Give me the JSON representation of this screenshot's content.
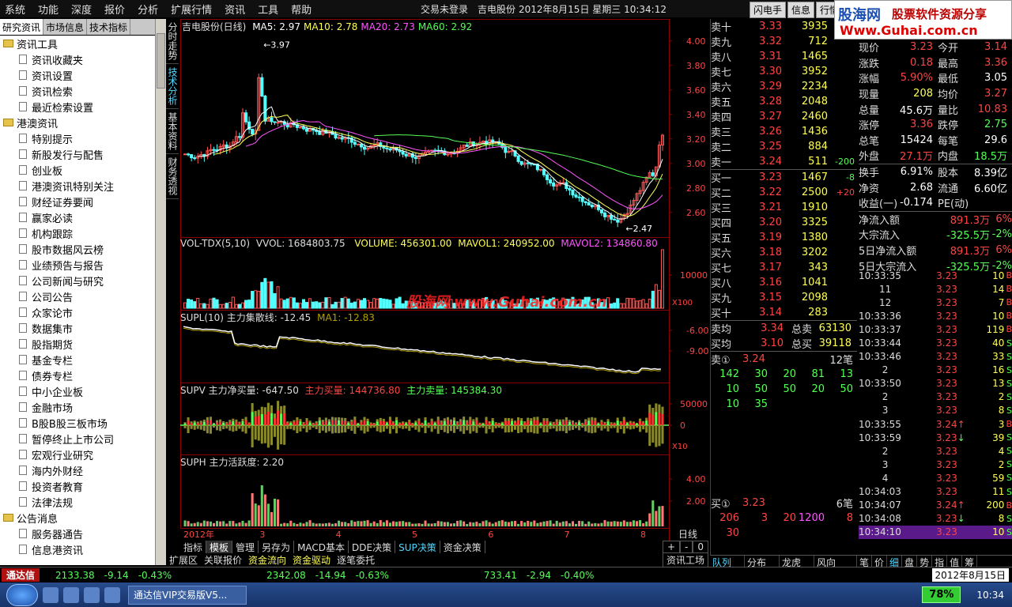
{
  "menu": [
    "系统",
    "功能",
    "深度",
    "报价",
    "分析",
    "扩展行情",
    "资讯",
    "工具",
    "帮助"
  ],
  "status": {
    "login": "交易未登录",
    "stock": "吉电股份",
    "datetime": "2012年8月15日  星期三  10:34:12"
  },
  "top_buttons": [
    "闪电手",
    "信息",
    "行情"
  ],
  "logo": {
    "name": "股海网",
    "slogan": "股票软件资源分享",
    "url": "Www.Guhai.com.cn"
  },
  "left_tabs": [
    "研究资讯",
    "市场信息",
    "技术指标"
  ],
  "tree": [
    {
      "t": "f",
      "label": "资讯工具"
    },
    {
      "t": "d",
      "label": "资讯收藏夹"
    },
    {
      "t": "d",
      "label": "资讯设置"
    },
    {
      "t": "d",
      "label": "资讯检索"
    },
    {
      "t": "d",
      "label": "最近检索设置"
    },
    {
      "t": "f",
      "label": "港澳资讯"
    },
    {
      "t": "d",
      "label": "特别提示"
    },
    {
      "t": "d",
      "label": "新股发行与配售"
    },
    {
      "t": "d",
      "label": "创业板"
    },
    {
      "t": "d",
      "label": "港澳资讯特别关注"
    },
    {
      "t": "d",
      "label": "财经证券要闻"
    },
    {
      "t": "d",
      "label": "赢家必读"
    },
    {
      "t": "d",
      "label": "机构跟踪"
    },
    {
      "t": "d",
      "label": "股市数据风云榜"
    },
    {
      "t": "d",
      "label": "业绩预告与报告"
    },
    {
      "t": "d",
      "label": "公司新闻与研究"
    },
    {
      "t": "d",
      "label": "公司公告"
    },
    {
      "t": "d",
      "label": "众家论市"
    },
    {
      "t": "d",
      "label": "数据集市"
    },
    {
      "t": "d",
      "label": "股指期货"
    },
    {
      "t": "d",
      "label": "基金专栏"
    },
    {
      "t": "d",
      "label": "债券专栏"
    },
    {
      "t": "d",
      "label": "中小企业板"
    },
    {
      "t": "d",
      "label": "金融市场"
    },
    {
      "t": "d",
      "label": "B股B股三板市场"
    },
    {
      "t": "d",
      "label": "暂停终止上市公司"
    },
    {
      "t": "d",
      "label": "宏观行业研究"
    },
    {
      "t": "d",
      "label": "海内外财经"
    },
    {
      "t": "d",
      "label": "投资者教育"
    },
    {
      "t": "d",
      "label": "法律法规"
    },
    {
      "t": "f",
      "label": "公告消息"
    },
    {
      "t": "d",
      "label": "服务器通告"
    },
    {
      "t": "d",
      "label": "信息港资讯"
    }
  ],
  "vtabs": [
    "分时走势",
    "技术分析",
    "基本资料",
    "财务透视"
  ],
  "chart_data": {
    "type": "candlestick",
    "title": "吉电股份(日线)",
    "ma": [
      {
        "name": "MA5",
        "value": "2.97",
        "color": "#ffffff"
      },
      {
        "name": "MA10",
        "value": "2.78",
        "color": "#ffff55"
      },
      {
        "name": "MA20",
        "value": "2.73",
        "color": "#ff55ff"
      },
      {
        "name": "MA60",
        "value": "2.92",
        "color": "#55ff55"
      }
    ],
    "ylim": [
      2.45,
      4.05
    ],
    "yticks": [
      "4.00",
      "3.80",
      "3.60",
      "3.40",
      "3.20",
      "3.00",
      "2.80",
      "2.60"
    ],
    "annotations": [
      {
        "label": "3.97",
        "y": 3.97
      },
      {
        "label": "2.47",
        "y": 2.47
      }
    ],
    "x_labels": [
      "2012年",
      "3",
      "4",
      "5",
      "6",
      "7",
      "8"
    ],
    "volume": {
      "title": "VOL-TDX(5,10)",
      "vvol": "VVOL: 1684803.75",
      "volume": "VOLUME: 456301.00",
      "mavol1": "MAVOL1: 240952.00",
      "mavol2": "MAVOL2: 134860.80",
      "ytick": "10000",
      "unit": "X100"
    },
    "supl": {
      "title": "SUPL(10) 主力集散线: -12.45",
      "ma1": "MA1: -12.83",
      "yticks": [
        "-6.00",
        "-9.00"
      ]
    },
    "supv": {
      "title": "SUPV 主力净买量: -647.50",
      "buy": "主力买量: 144736.80",
      "sell": "主力卖量: 145384.30",
      "yticks": [
        "50000",
        "0"
      ],
      "unit": "X10"
    },
    "suph": {
      "title": "SUPH 主力活跃度: 2.20",
      "yticks": [
        "4.00",
        "2.00"
      ]
    },
    "period": "日线"
  },
  "watermark": "股海网  www.Guhai.com.cn",
  "bottom_tabs": [
    "指标",
    "模板",
    "管理",
    "另存为",
    "MACD基本",
    "DDE决策",
    "SUP决策",
    "资金决策"
  ],
  "chart_nav": [
    "+",
    "-",
    "0"
  ],
  "ext_tabs": [
    "扩展区",
    "关联报价",
    "资金流向",
    "资金驱动",
    "逐笔委托"
  ],
  "ext_right": "资讯工场",
  "asks": [
    [
      "卖十",
      "3.33",
      "3935",
      ""
    ],
    [
      "卖九",
      "3.32",
      "712",
      ""
    ],
    [
      "卖八",
      "3.31",
      "1465",
      ""
    ],
    [
      "卖七",
      "3.30",
      "3952",
      ""
    ],
    [
      "卖六",
      "3.29",
      "2234",
      ""
    ],
    [
      "卖五",
      "3.28",
      "2048",
      ""
    ],
    [
      "卖四",
      "3.27",
      "2460",
      ""
    ],
    [
      "卖三",
      "3.26",
      "1436",
      ""
    ],
    [
      "卖二",
      "3.25",
      "884",
      ""
    ],
    [
      "卖一",
      "3.24",
      "511",
      "-200"
    ]
  ],
  "bids": [
    [
      "买一",
      "3.23",
      "1467",
      "-8"
    ],
    [
      "买二",
      "3.22",
      "2500",
      "+20"
    ],
    [
      "买三",
      "3.21",
      "1910",
      ""
    ],
    [
      "买四",
      "3.20",
      "3325",
      ""
    ],
    [
      "买五",
      "3.19",
      "1380",
      ""
    ],
    [
      "买六",
      "3.18",
      "3202",
      ""
    ],
    [
      "买七",
      "3.17",
      "343",
      ""
    ],
    [
      "买八",
      "3.16",
      "1041",
      ""
    ],
    [
      "买九",
      "3.15",
      "2098",
      ""
    ],
    [
      "买十",
      "3.14",
      "283",
      ""
    ]
  ],
  "avg": {
    "ask_label": "卖均",
    "ask_price": "3.34",
    "total_ask_label": "总卖",
    "total_ask": "63130",
    "bid_label": "买均",
    "bid_price": "3.10",
    "total_bid_label": "总买",
    "total_bid": "39118"
  },
  "queue1": {
    "label": "卖①",
    "price": "3.24",
    "count": "12笔",
    "rows": [
      [
        "142",
        "30",
        "20",
        "81",
        "13"
      ],
      [
        "10",
        "50",
        "50",
        "20",
        "50"
      ],
      [
        "10",
        "35",
        "",
        "",
        ""
      ]
    ]
  },
  "queue2": {
    "label": "买①",
    "price": "3.23",
    "count": "6笔",
    "rows": [
      [
        "206",
        "3",
        "20",
        "1200",
        "8"
      ],
      [
        "30",
        "",
        "",
        "",
        ""
      ]
    ]
  },
  "quote": [
    [
      "现价",
      "3.23",
      "今开",
      "3.14"
    ],
    [
      "涨跌",
      "0.18",
      "最高",
      "3.36"
    ],
    [
      "涨幅",
      "5.90%",
      "最低",
      "3.05"
    ],
    [
      "现量",
      "208",
      "均价",
      "3.27"
    ],
    [
      "总量",
      "45.6万",
      "量比",
      "10.83"
    ],
    [
      "涨停",
      "3.36",
      "跌停",
      "2.75"
    ],
    [
      "总笔",
      "15424",
      "每笔",
      "29.6"
    ],
    [
      "外盘",
      "27.1万",
      "内盘",
      "18.5万"
    ],
    [
      "换手",
      "6.91%",
      "股本",
      "8.39亿"
    ],
    [
      "净资",
      "2.68",
      "流通",
      "6.60亿"
    ],
    [
      "收益(一)",
      "-0.174",
      "PE(动)",
      ""
    ],
    [
      "净流入额",
      "891.3万",
      "",
      "6%"
    ],
    [
      "大宗流入",
      "-325.5万",
      "",
      "-2%"
    ],
    [
      "5日净流入额",
      "891.3万",
      "",
      "6%"
    ],
    [
      "5日大宗流入",
      "-325.5万",
      "",
      "-2%"
    ]
  ],
  "ticks": [
    [
      "10:33:35",
      "3.23",
      "10",
      "B",
      ""
    ],
    [
      "11",
      "3.23",
      "14",
      "B",
      ""
    ],
    [
      "12",
      "3.23",
      "7",
      "B",
      ""
    ],
    [
      "10:33:36",
      "3.23",
      "10",
      "B",
      ""
    ],
    [
      "10:33:37",
      "3.23",
      "119",
      "B",
      ""
    ],
    [
      "10:33:44",
      "3.23",
      "40",
      "S",
      ""
    ],
    [
      "10:33:46",
      "3.23",
      "33",
      "S",
      ""
    ],
    [
      "2",
      "3.23",
      "16",
      "S",
      ""
    ],
    [
      "10:33:50",
      "3.23",
      "13",
      "S",
      ""
    ],
    [
      "2",
      "3.23",
      "2",
      "S",
      ""
    ],
    [
      "3",
      "3.23",
      "8",
      "S",
      ""
    ],
    [
      "10:33:55",
      "3.24",
      "3",
      "B",
      "↑"
    ],
    [
      "10:33:59",
      "3.23",
      "39",
      "S",
      "↓"
    ],
    [
      "2",
      "3.23",
      "4",
      "S",
      ""
    ],
    [
      "3",
      "3.23",
      "2",
      "S",
      ""
    ],
    [
      "4",
      "3.23",
      "59",
      "S",
      ""
    ],
    [
      "10:34:03",
      "3.23",
      "11",
      "S",
      ""
    ],
    [
      "10:34:07",
      "3.24",
      "200",
      "B",
      "↑"
    ],
    [
      "10:34:08",
      "3.23",
      "8",
      "S",
      "↓"
    ],
    [
      "10:34:10",
      "3.23",
      "10",
      "S",
      ""
    ]
  ],
  "right_bottom_left": [
    "队列",
    "分布",
    "龙虎",
    "风向"
  ],
  "right_bottom_right": [
    "笔",
    "价",
    "细",
    "盘",
    "势",
    "指",
    "值",
    "筹"
  ],
  "statusbar": {
    "name": "通达信",
    "sh_index": "2133.38",
    "sh_chg": "-9.14",
    "sh_pct": "-0.43%",
    "idx2": "2342.08",
    "idx2_chg": "-14.94",
    "idx2_pct": "-0.63%",
    "idx3": "733.41",
    "idx3_chg": "-2.94",
    "idx3_pct": "-0.40%",
    "date": "2012年8月15日"
  },
  "taskbar": {
    "app": "通达信VIP交易版V5...",
    "battery": "78%",
    "time": "10:34"
  }
}
